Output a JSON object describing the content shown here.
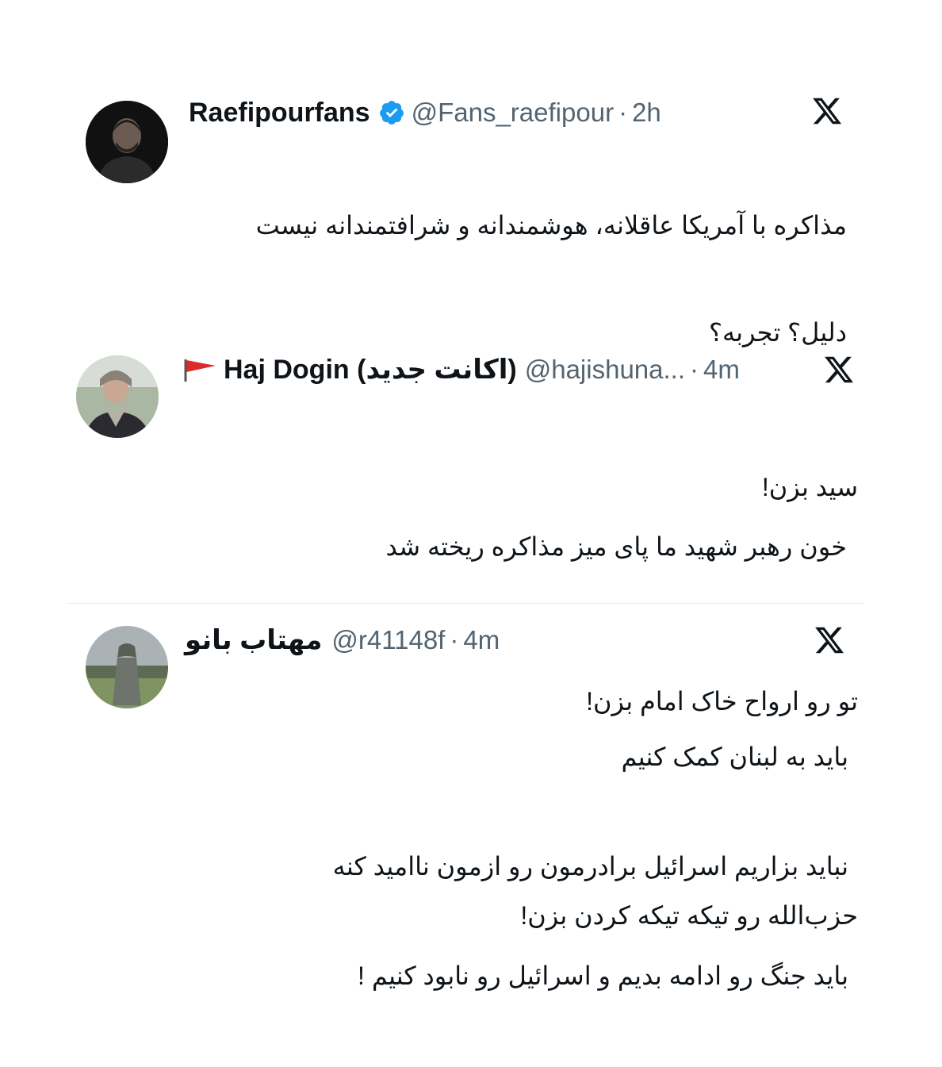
{
  "tweets": [
    {
      "name": "Raefipourfans",
      "verified": true,
      "handle": "@Fans_raefipour",
      "time": "2h",
      "lines": [
        "مذاکره با آمریکا عاقلانه، هوشمندانه و شرافتمندانه نیست",
        "دلیل؟ تجربه؟",
        "",
        "خون رهبر شهید ما پای میز مذاکره ریخته شد"
      ]
    },
    {
      "name": "Haj Dogin (اکانت جدید)",
      "has_flag": true,
      "flag_color": "#d92b2b",
      "handle": "@hajishuna...",
      "time": "4m",
      "lines": [
        "سید بزن!",
        "",
        "تو رو ارواح خاک امام بزن!",
        "",
        "حزب‌الله رو تیکه تیکه کردن بزن!"
      ]
    },
    {
      "name": "مهتاب بانو",
      "handle": "@r41148f",
      "time": "4m",
      "lines": [
        "باید به لبنان کمک کنیم",
        "نباید بزاریم اسرائیل برادرمون رو ازمون ناامید کنه",
        "باید جنگ رو ادامه بدیم و اسرائیل رو نابود کنیم !"
      ]
    }
  ],
  "icons": {
    "brand": "x-logo-icon",
    "verified": "verified-badge-icon",
    "flag": "red-flag-icon"
  },
  "colors": {
    "text": "#0f1419",
    "secondary": "#536471",
    "verified_blue": "#1d9bf0",
    "divider": "#e6e9ec"
  },
  "separator": "·"
}
